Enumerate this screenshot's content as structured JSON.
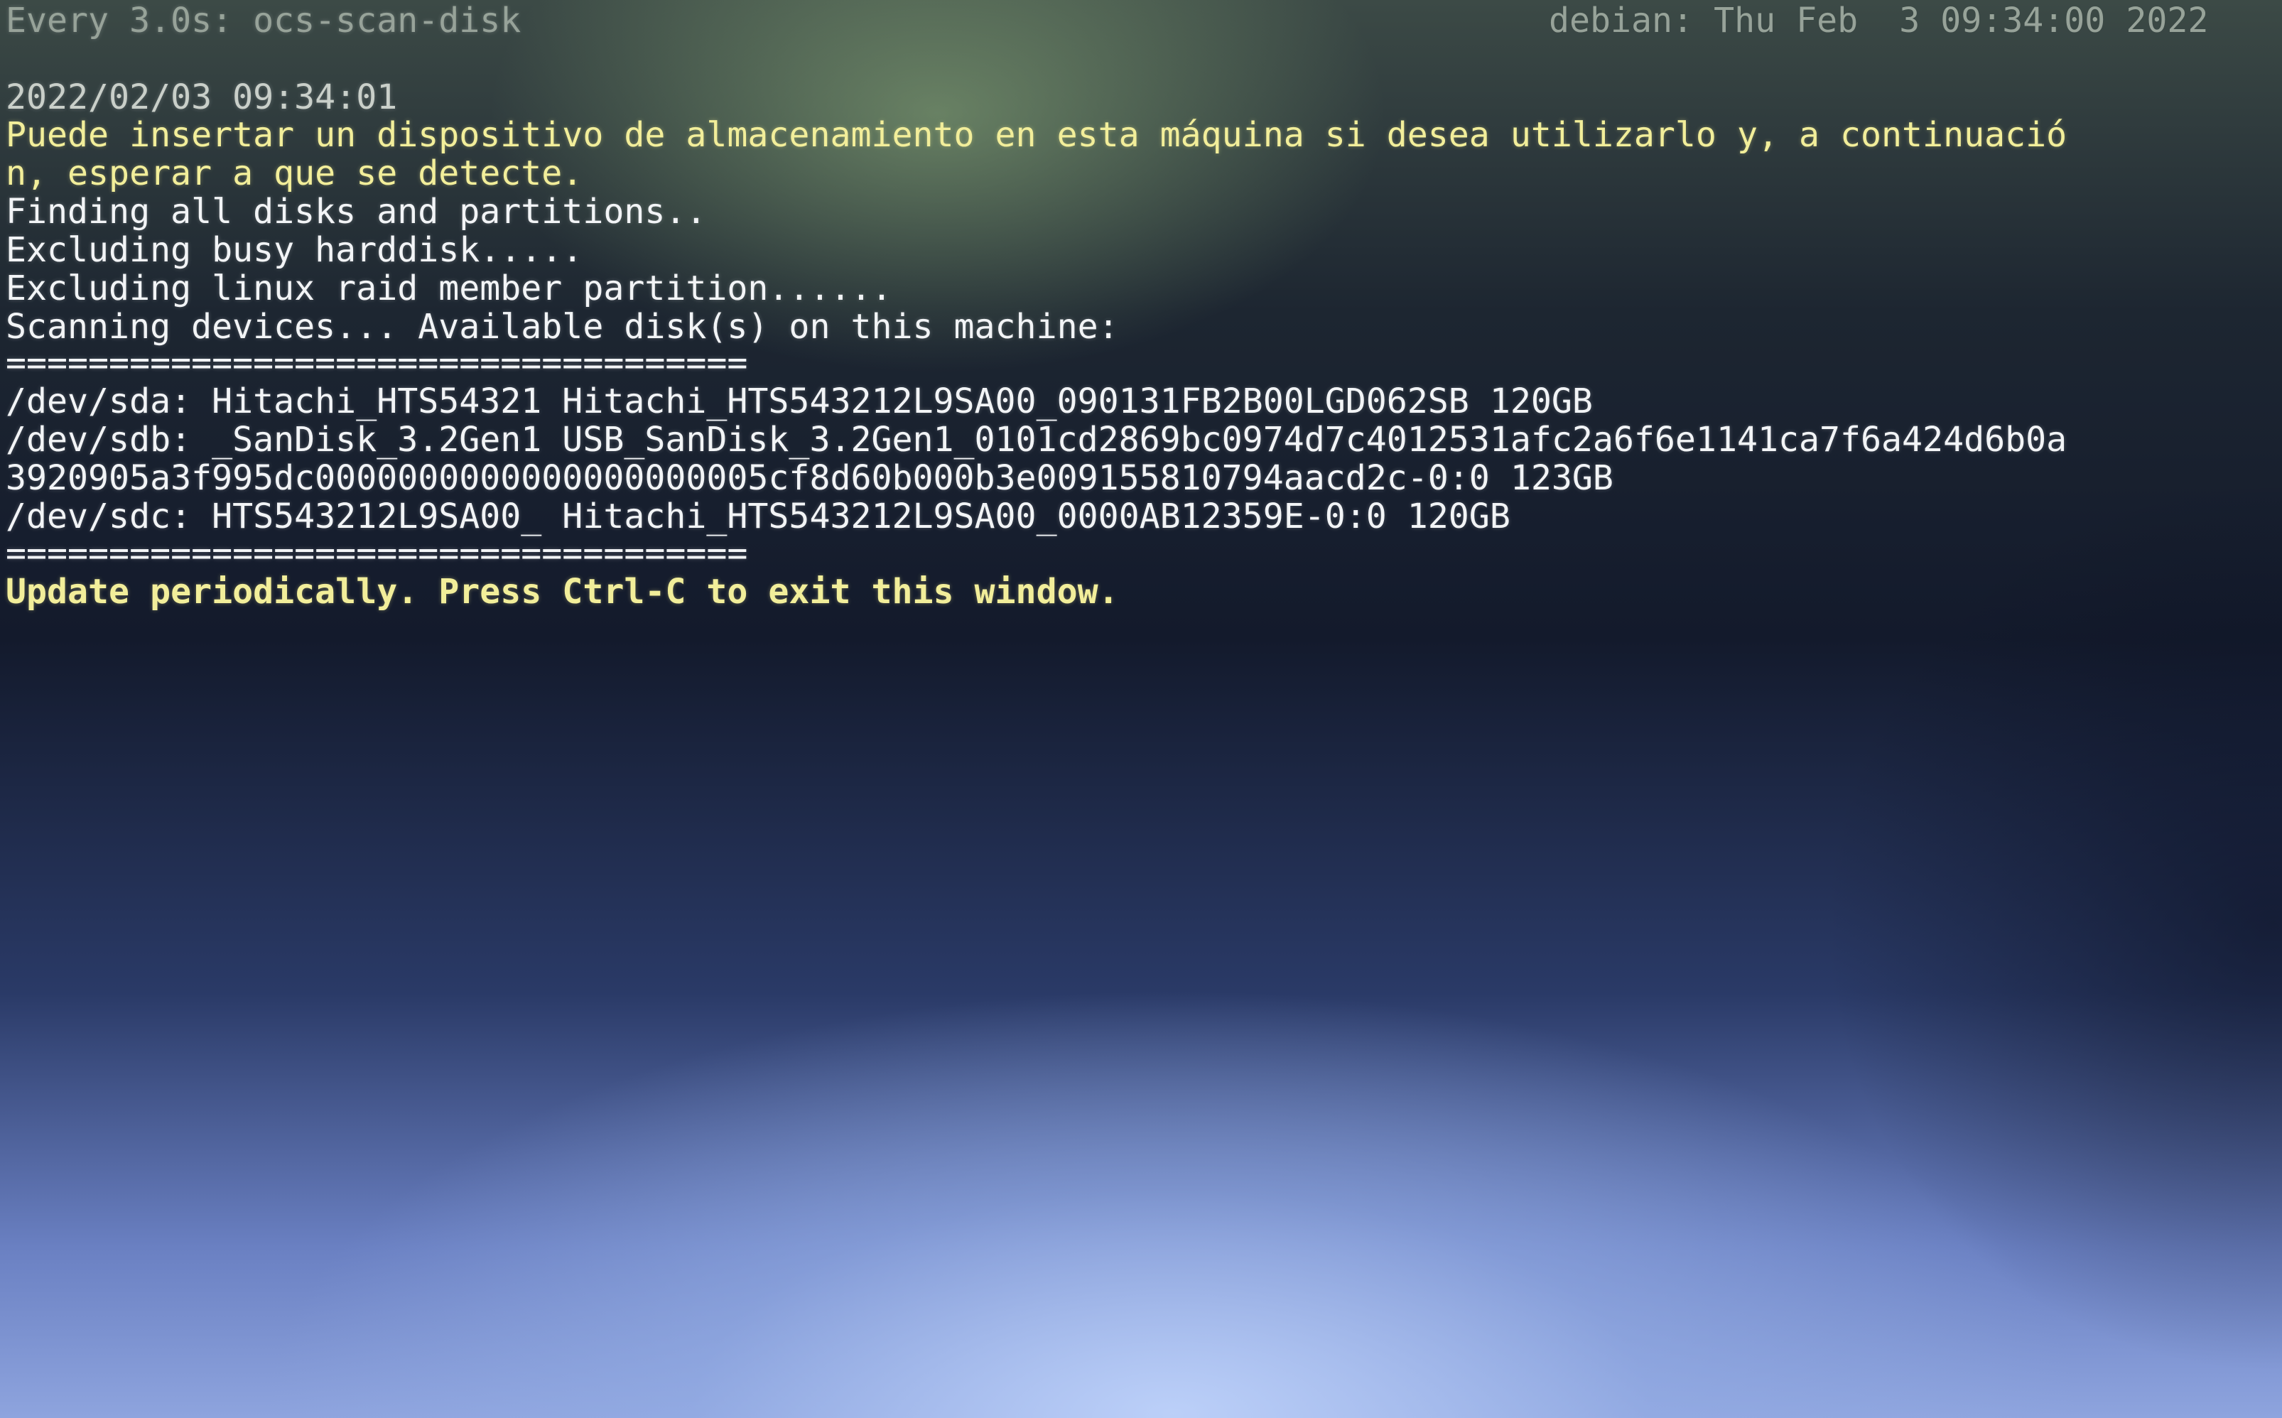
{
  "header": {
    "watch_command": "Every 3.0s: ocs-scan-disk",
    "host_info": "debian: Thu Feb  3 09:34:00 2022"
  },
  "timestamp": "2022/02/03 09:34:01",
  "prompt": {
    "line1": "Puede insertar un dispositivo de almacenamiento en esta máquina si desea utilizarlo y, a continuació",
    "line2": "n, esperar a que se detecte."
  },
  "progress": {
    "finding": "Finding all disks and partitions..",
    "busy": "Excluding busy harddisk.....",
    "raid": "Excluding linux raid member partition......",
    "scanning": "Scanning devices... Available disk(s) on this machine:"
  },
  "separator": "====================================",
  "disks": [
    "/dev/sda: Hitachi_HTS54321 Hitachi_HTS543212L9SA00_090131FB2B00LGD062SB 120GB",
    "/dev/sdb: _SanDisk_3.2Gen1 USB_SanDisk_3.2Gen1_0101cd2869bc0974d7c4012531afc2a6f6e1141ca7f6a424d6b0a",
    "3920905a3f995dc0000000000000000000005cf8d60b000b3e009155810794aacd2c-0:0 123GB",
    "/dev/sdc: HTS543212L9SA00_ Hitachi_HTS543212L9SA00_0000AB12359E-0:0 120GB"
  ],
  "footer": "Update periodically. Press Ctrl-C to exit this window.",
  "colors": {
    "yellow_text": "#f2ee9a",
    "white_text": "#f2f4f6",
    "header_text": "#a8b3a8"
  }
}
